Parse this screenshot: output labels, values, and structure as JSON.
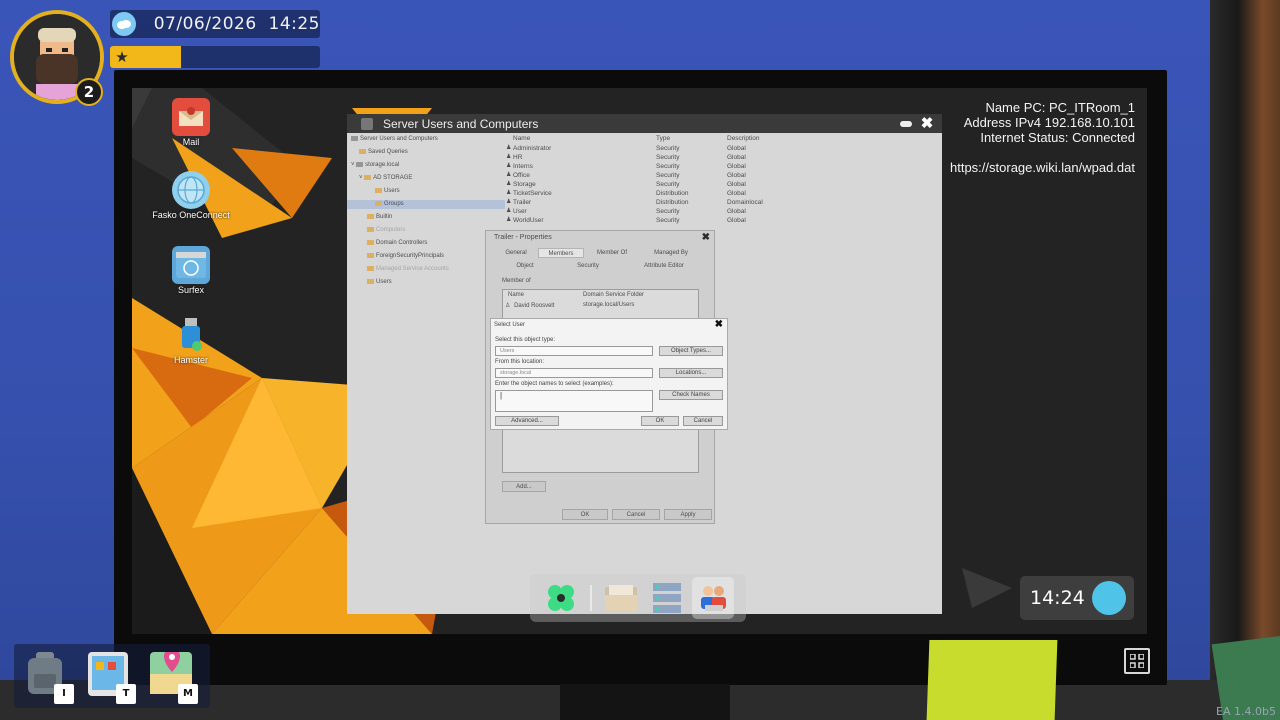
{
  "hud": {
    "date": "07/06/2026",
    "time": "14:25",
    "datetime_text": "07/06/2026  14:25",
    "level": "2",
    "xp_fraction": 0.25
  },
  "desktop": {
    "icons": [
      {
        "label": "Mail",
        "icon": "mail-icon"
      },
      {
        "label": "Fasko OneConnect",
        "icon": "globe-icon"
      },
      {
        "label": "Surfex",
        "icon": "browser-icon"
      },
      {
        "label": "Hamster",
        "icon": "usb-icon"
      }
    ],
    "netinfo": {
      "name_pc": "Name PC: PC_ITRoom_1",
      "address": "Address IPv4 192.168.10.101",
      "internet": "Internet Status: Connected",
      "url": "https://storage.wiki.lan/wpad.dat"
    }
  },
  "window": {
    "title": "Server Users and Computers",
    "tree": [
      {
        "label": "Server Users and Computers"
      },
      {
        "label": "Saved Queries"
      },
      {
        "label": "storage.local"
      },
      {
        "label": "AD STORAGE"
      },
      {
        "label": "Users"
      },
      {
        "label": "Groups"
      },
      {
        "label": "Builtin"
      },
      {
        "label": "Computers"
      },
      {
        "label": "Domain Controllers"
      },
      {
        "label": "ForeignSecurityPrincipals"
      },
      {
        "label": "Managed Service Accounts"
      },
      {
        "label": "Users"
      }
    ],
    "columns": [
      "Name",
      "Type",
      "Description"
    ],
    "rows": [
      [
        "Administrator",
        "Security",
        "Global"
      ],
      [
        "HR",
        "Security",
        "Global"
      ],
      [
        "Interns",
        "Security",
        "Global"
      ],
      [
        "Office",
        "Security",
        "Global"
      ],
      [
        "Storage",
        "Security",
        "Global"
      ],
      [
        "TicketService",
        "Distribution",
        "Global"
      ],
      [
        "Trailer",
        "Distribution",
        "Domainlocal"
      ],
      [
        "User",
        "Security",
        "Global"
      ],
      [
        "WorldUser",
        "Security",
        "Global"
      ]
    ]
  },
  "properties": {
    "title": "Trailer - Properties",
    "tabs_row1": [
      "General",
      "Members",
      "Member Of",
      "Managed By"
    ],
    "tabs_row2": [
      "Object",
      "Security",
      "Attribute Editor"
    ],
    "member_of_label": "Member of",
    "col_name": "Name",
    "col_folder": "Domain Service Folder",
    "member_name": "David Roosvelt",
    "member_folder": "storage.local/Users",
    "add_label": "Add...",
    "ok_label": "OK",
    "cancel_label": "Cancel",
    "apply_label": "Apply"
  },
  "select_user": {
    "title": "Select User",
    "object_type_label": "Select this object type:",
    "object_type_value": "Users",
    "object_types_button": "Object Types...",
    "location_label": "From this location:",
    "location_value": "storage.local",
    "locations_button": "Locations...",
    "names_label": "Enter the object names to select (examples):",
    "names_value": "|",
    "check_names_button": "Check Names",
    "advanced_button": "Advanced...",
    "ok_button": "OK",
    "cancel_button": "Cancel"
  },
  "taskbar": {
    "items": [
      "start-icon",
      "folder-icon",
      "server-icon",
      "users-icon"
    ]
  },
  "clock": {
    "time": "14:24"
  },
  "inventory": [
    {
      "icon": "backpack-icon",
      "key": "I"
    },
    {
      "icon": "tablet-icon",
      "key": "T"
    },
    {
      "icon": "map-icon",
      "key": "M"
    }
  ],
  "version": "EA 1.4.0b5",
  "colors": {
    "accent_gold": "#e3b11e",
    "wallpaper_orange": "#f2a21a",
    "screen_dark": "#242424"
  }
}
